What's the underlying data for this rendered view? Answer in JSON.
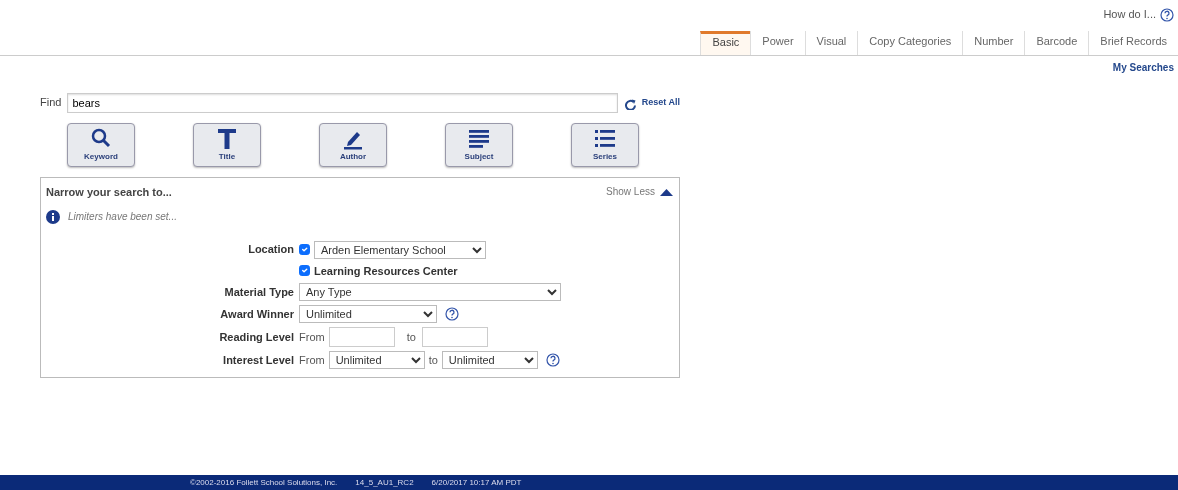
{
  "help": {
    "label": "How do I..."
  },
  "tabs": [
    {
      "label": "Basic",
      "selected": true
    },
    {
      "label": "Power",
      "selected": false
    },
    {
      "label": "Visual",
      "selected": false
    },
    {
      "label": "Copy Categories",
      "selected": false
    },
    {
      "label": "Number",
      "selected": false
    },
    {
      "label": "Barcode",
      "selected": false
    },
    {
      "label": "Brief Records",
      "selected": false
    }
  ],
  "my_searches": "My Searches",
  "find": {
    "label": "Find",
    "value": "bears"
  },
  "reset": "Reset All",
  "search_buttons": [
    {
      "label": "Keyword",
      "kind": "keyword"
    },
    {
      "label": "Title",
      "kind": "title"
    },
    {
      "label": "Author",
      "kind": "author"
    },
    {
      "label": "Subject",
      "kind": "subject"
    },
    {
      "label": "Series",
      "kind": "series"
    }
  ],
  "narrow": {
    "title": "Narrow your search to...",
    "toggle": "Show Less",
    "notice": "Limiters have been set...",
    "fields": [
      {
        "kind": "location",
        "label": "Location",
        "checked": true,
        "value": "Arden Elementary School"
      },
      {
        "kind": "checkbox",
        "label": "Learning Resources Center",
        "checked": true
      },
      {
        "kind": "select",
        "label": "Material Type",
        "value": "Any Type",
        "help": false
      },
      {
        "kind": "select",
        "label": "Award Winner",
        "value": "Unlimited",
        "help": true
      },
      {
        "kind": "range-text",
        "label": "Reading Level",
        "from": "From",
        "to": "to"
      },
      {
        "kind": "range-select",
        "label": "Interest Level",
        "from": "From",
        "from_value": "Unlimited",
        "to": "to",
        "to_value": "Unlimited",
        "help": true
      }
    ]
  },
  "footer": [
    "©2002-2016 Follett School Solutions, Inc.",
    "14_5_AU1_RC2",
    "6/20/2017 10:17 AM PDT"
  ]
}
